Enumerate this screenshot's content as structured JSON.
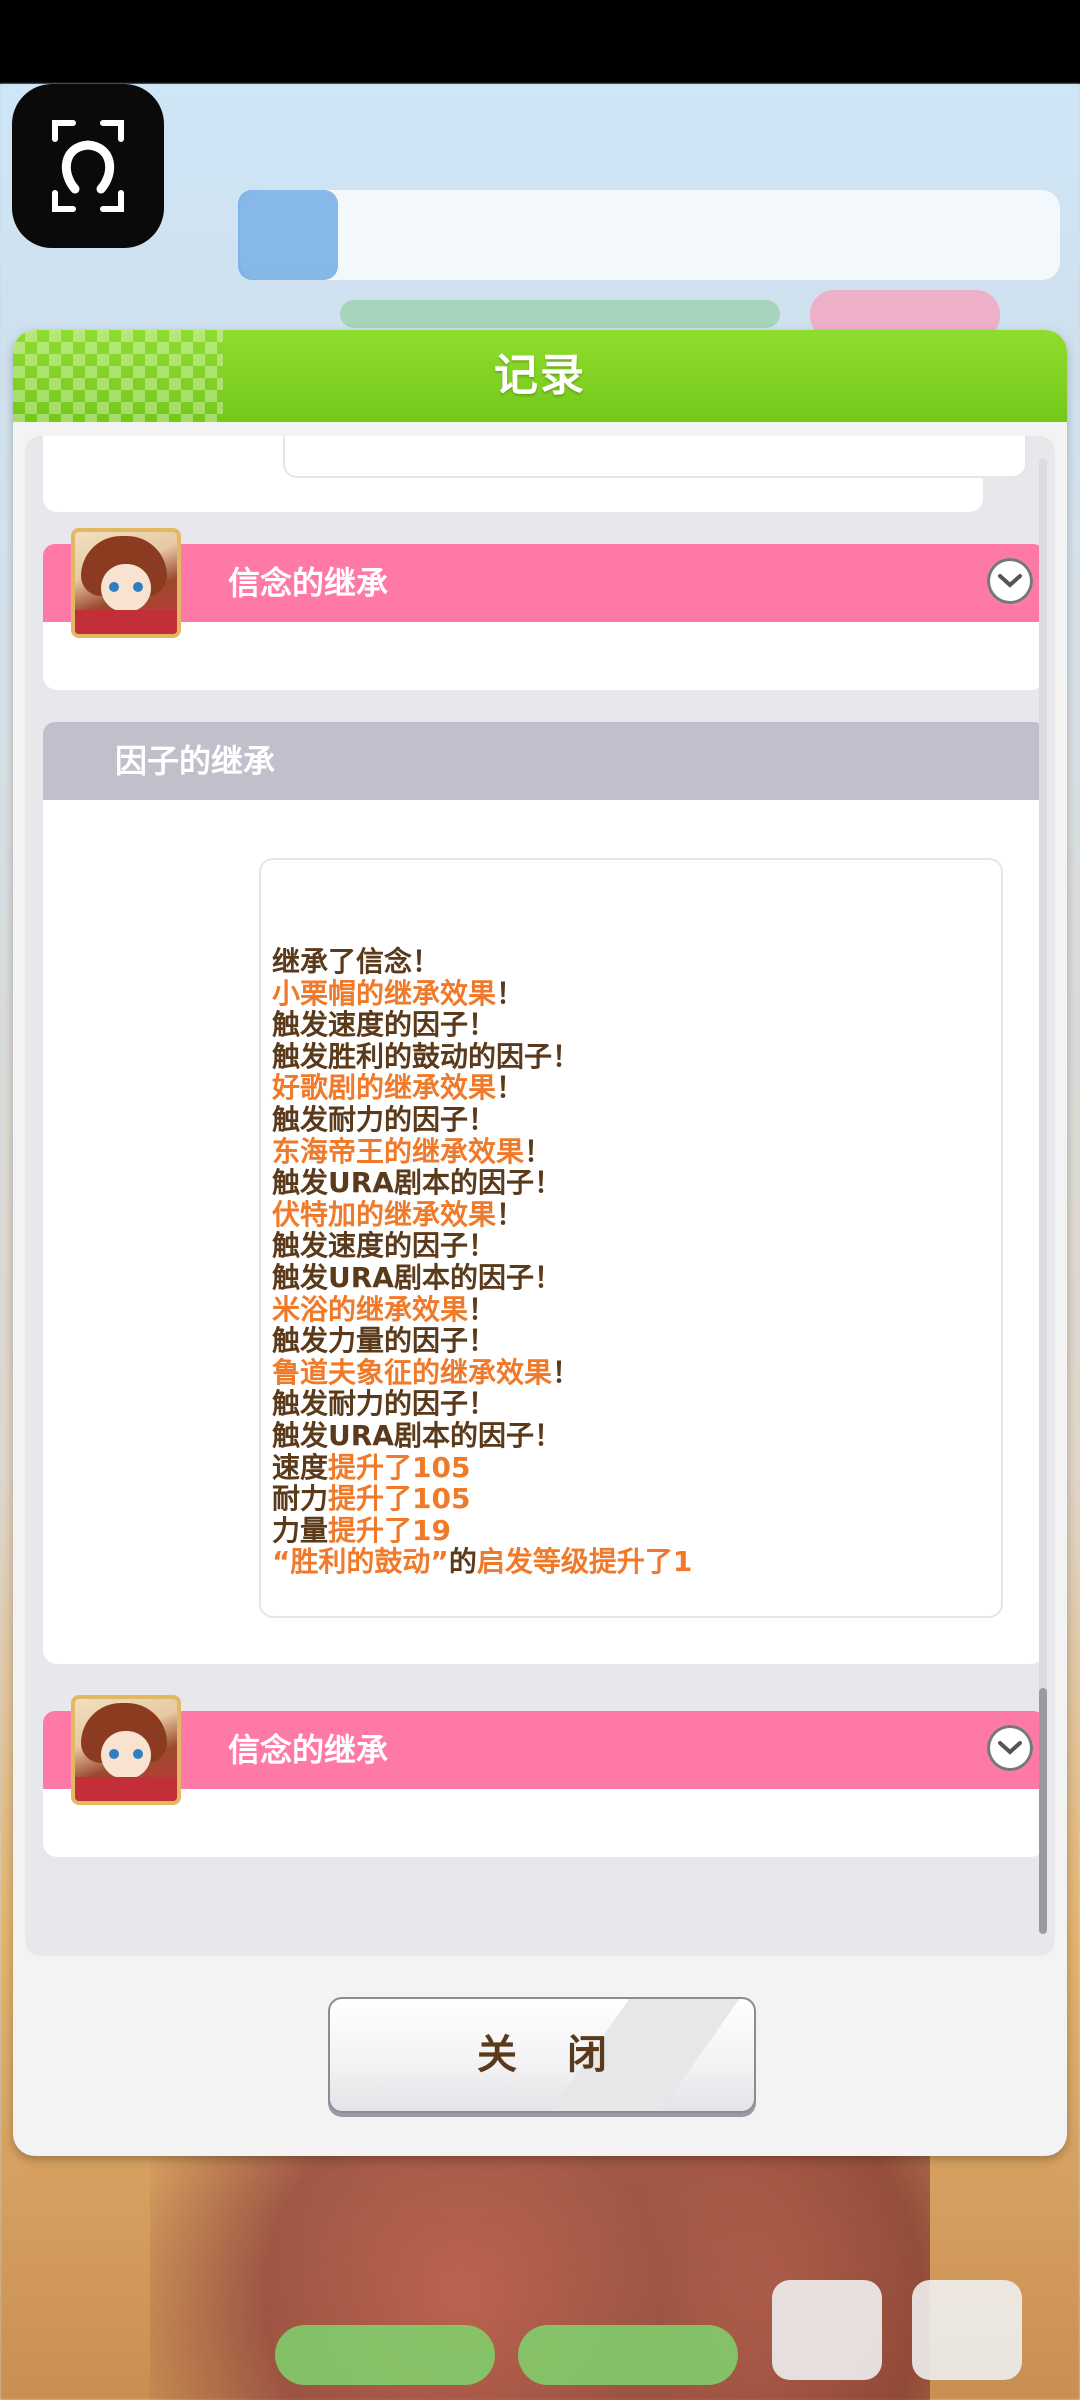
{
  "modal": {
    "title": "记录",
    "close_label": "关 闭"
  },
  "log": {
    "entries": [
      {
        "type": "belief",
        "label": "信念的继承"
      },
      {
        "type": "factor",
        "label": "因子的继承"
      },
      {
        "type": "belief",
        "label": "信念的继承"
      }
    ],
    "factor_lines": [
      [
        {
          "t": "继承了信念！",
          "c": "dark"
        }
      ],
      [
        {
          "t": "小栗帽的继承效果",
          "c": "orange"
        },
        {
          "t": "！",
          "c": "dark"
        }
      ],
      [
        {
          "t": "触发速度的因子！",
          "c": "dark"
        }
      ],
      [
        {
          "t": "触发胜利的鼓动的因子！",
          "c": "dark"
        }
      ],
      [
        {
          "t": "好歌剧的继承效果",
          "c": "orange"
        },
        {
          "t": "！",
          "c": "dark"
        }
      ],
      [
        {
          "t": "触发耐力的因子！",
          "c": "dark"
        }
      ],
      [
        {
          "t": "东海帝王的继承效果",
          "c": "orange"
        },
        {
          "t": "！",
          "c": "dark"
        }
      ],
      [
        {
          "t": "触发URA剧本的因子！",
          "c": "dark"
        }
      ],
      [
        {
          "t": "伏特加的继承效果",
          "c": "orange"
        },
        {
          "t": "！",
          "c": "dark"
        }
      ],
      [
        {
          "t": "触发速度的因子！",
          "c": "dark"
        }
      ],
      [
        {
          "t": "触发URA剧本的因子！",
          "c": "dark"
        }
      ],
      [
        {
          "t": "米浴的继承效果",
          "c": "orange"
        },
        {
          "t": "！",
          "c": "dark"
        }
      ],
      [
        {
          "t": "触发力量的因子！",
          "c": "dark"
        }
      ],
      [
        {
          "t": "鲁道夫象征的继承效果",
          "c": "orange"
        },
        {
          "t": "！",
          "c": "dark"
        }
      ],
      [
        {
          "t": "触发耐力的因子！",
          "c": "dark"
        }
      ],
      [
        {
          "t": "触发URA剧本的因子！",
          "c": "dark"
        }
      ],
      [
        {
          "t": "速度",
          "c": "dark"
        },
        {
          "t": "提升了105",
          "c": "orange"
        }
      ],
      [
        {
          "t": "耐力",
          "c": "dark"
        },
        {
          "t": "提升了105",
          "c": "orange"
        }
      ],
      [
        {
          "t": "力量",
          "c": "dark"
        },
        {
          "t": "提升了19",
          "c": "orange"
        }
      ],
      [
        {
          "t": "“胜利的鼓动”",
          "c": "orange"
        },
        {
          "t": "的",
          "c": "dark"
        },
        {
          "t": "启发等级提升了1",
          "c": "orange"
        }
      ]
    ]
  },
  "colors": {
    "header_green": "#74c81a",
    "pink_bar": "#ff79a6",
    "gray_bar": "#c0c0cc",
    "text_dark": "#5a3a1a",
    "text_orange": "#f07a2a"
  },
  "icons": {
    "camera_button": "horseshoe-icon",
    "expand": "chevron-down-icon"
  }
}
